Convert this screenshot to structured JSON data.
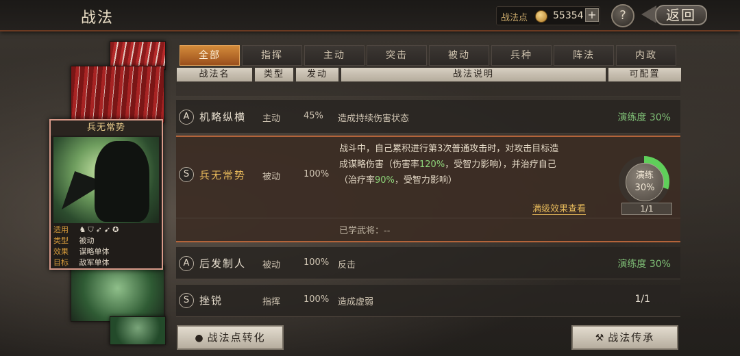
{
  "header": {
    "title": "战法",
    "points_label": "战法点",
    "points_value": "55354",
    "plus_label": "+",
    "help_label": "?",
    "back_label": "返回"
  },
  "card": {
    "name": "兵无常势",
    "rows": [
      {
        "key": "适用",
        "value": ""
      },
      {
        "key": "类型",
        "value": "被动"
      },
      {
        "key": "效果",
        "value": "谋略单体"
      },
      {
        "key": "目标",
        "value": "敌军单体"
      }
    ],
    "unit_icons": [
      "cavalry-icon",
      "shield-icon",
      "bow-icon",
      "spear-icon",
      "siege-icon"
    ]
  },
  "tabs": [
    "全部",
    "指挥",
    "主动",
    "突击",
    "被动",
    "兵种",
    "阵法",
    "内政"
  ],
  "active_tab": "全部",
  "columns": [
    "战法名",
    "类型",
    "发动",
    "战法说明",
    "可配置"
  ],
  "rows": [
    {
      "grade": "A",
      "name": "机略纵横",
      "type": "主动",
      "rate": "45%",
      "desc": "造成持续伤害状态",
      "cfg": "演练度 30%",
      "cfg_green": true
    },
    {
      "grade": "A",
      "name": "后发制人",
      "type": "被动",
      "rate": "100%",
      "desc": "反击",
      "cfg": "演练度 30%",
      "cfg_green": true
    },
    {
      "grade": "S",
      "name": "挫锐",
      "type": "指挥",
      "rate": "100%",
      "desc": "造成虚弱",
      "cfg": "1/1",
      "cfg_green": false
    }
  ],
  "expanded": {
    "grade": "S",
    "name": "兵无常势",
    "type": "被动",
    "rate": "100%",
    "desc_1": "战斗中，自己累积进行第3次普通攻击时，对攻击目标造",
    "desc_2a": "成谋略伤害（伤害率",
    "desc_2b": "120%",
    "desc_2c": "，受智力影响），并治疗自己",
    "desc_3a": "（治疗率",
    "desc_3b": "90%",
    "desc_3c": "，受智力影响）",
    "more_link": "满级效果查看",
    "learned_label": "已学武将：--",
    "ring_label": "演练",
    "ring_value": "30%",
    "ring_progress": 0.3,
    "count": "1/1"
  },
  "buttons": {
    "convert": "战法点转化",
    "inherit": "战法传承"
  }
}
